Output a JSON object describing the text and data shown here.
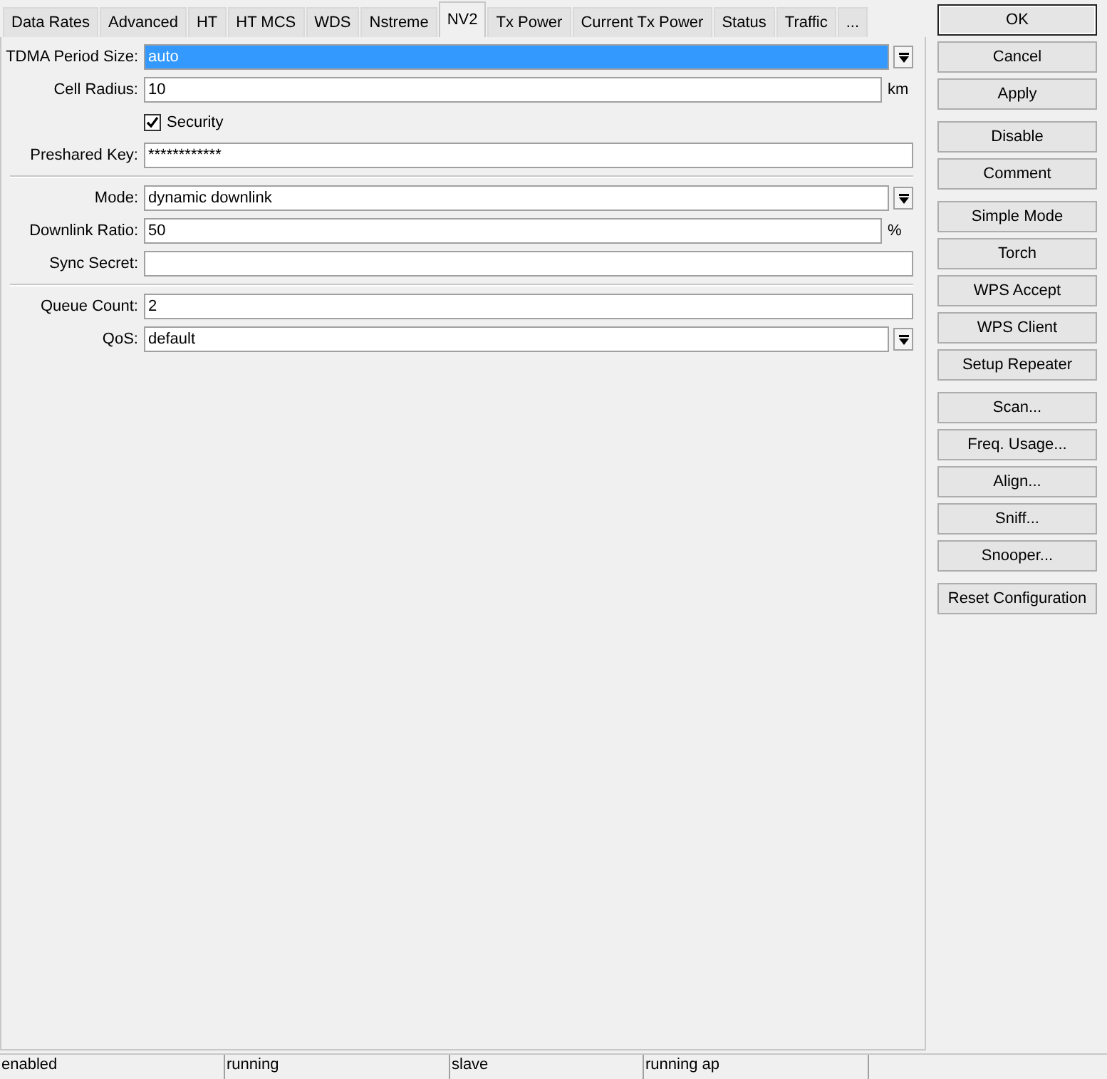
{
  "tabs": [
    {
      "label": "Data Rates",
      "selected": false
    },
    {
      "label": "Advanced",
      "selected": false
    },
    {
      "label": "HT",
      "selected": false
    },
    {
      "label": "HT MCS",
      "selected": false
    },
    {
      "label": "WDS",
      "selected": false
    },
    {
      "label": "Nstreme",
      "selected": false
    },
    {
      "label": "NV2",
      "selected": true
    },
    {
      "label": "Tx Power",
      "selected": false
    },
    {
      "label": "Current Tx Power",
      "selected": false
    },
    {
      "label": "Status",
      "selected": false
    },
    {
      "label": "Traffic",
      "selected": false
    },
    {
      "label": "...",
      "selected": false
    }
  ],
  "sections": [
    {
      "rows": [
        {
          "kind": "dropdown",
          "label": "TDMA Period Size:",
          "value": "auto",
          "focused": true
        },
        {
          "kind": "text",
          "label": "Cell Radius:",
          "value": "10",
          "unit": "km",
          "focused": false
        },
        {
          "kind": "checkbox",
          "label": "Security",
          "checked": true
        },
        {
          "kind": "text",
          "label": "Preshared Key:",
          "value": "************",
          "focused": false
        }
      ]
    },
    {
      "rows": [
        {
          "kind": "dropdown",
          "label": "Mode:",
          "value": "dynamic downlink",
          "focused": false
        },
        {
          "kind": "text",
          "label": "Downlink Ratio:",
          "value": "50",
          "unit": "%",
          "focused": false
        },
        {
          "kind": "text",
          "label": "Sync Secret:",
          "focused": false
        }
      ]
    },
    {
      "rows": [
        {
          "kind": "text",
          "label": "Queue Count:",
          "value": "2",
          "focused": false
        },
        {
          "kind": "dropdown",
          "label": "QoS:",
          "value": "default",
          "focused": false
        }
      ]
    }
  ],
  "button_groups": [
    [
      {
        "label": "OK",
        "default": true
      },
      {
        "label": "Cancel",
        "default": false
      },
      {
        "label": "Apply",
        "default": false
      }
    ],
    [
      {
        "label": "Disable",
        "default": false
      },
      {
        "label": "Comment",
        "default": false
      }
    ],
    [
      {
        "label": "Simple Mode",
        "default": false
      },
      {
        "label": "Torch",
        "default": false
      },
      {
        "label": "WPS Accept",
        "default": false
      },
      {
        "label": "WPS Client",
        "default": false
      },
      {
        "label": "Setup Repeater",
        "default": false
      }
    ],
    [
      {
        "label": "Scan...",
        "default": false
      },
      {
        "label": "Freq. Usage...",
        "default": false
      },
      {
        "label": "Align...",
        "default": false
      },
      {
        "label": "Sniff...",
        "default": false
      },
      {
        "label": "Snooper...",
        "default": false
      }
    ],
    [
      {
        "label": "Reset Configuration",
        "default": false
      }
    ]
  ],
  "status_bar": [
    "enabled",
    "running",
    "slave",
    "running ap"
  ]
}
